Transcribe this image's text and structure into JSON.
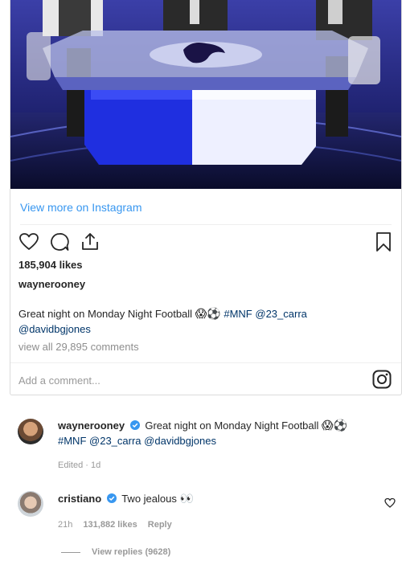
{
  "embed": {
    "view_more": "View more on Instagram",
    "likes": "185,904 likes",
    "username": "waynerooney",
    "caption_text": "Great night on Monday Night Football",
    "caption_emojis": "😱⚽",
    "caption_tags": [
      "#MNF",
      "@23_carra",
      "@davidbgjones"
    ],
    "view_all": "view all 29,895 comments",
    "add_comment_placeholder": "Add a comment...",
    "icons": [
      "heart-icon",
      "comment-icon",
      "share-icon",
      "bookmark-icon",
      "instagram-icon"
    ]
  },
  "comments": [
    {
      "user": "waynerooney",
      "text": "Great night on Monday Night Football",
      "emojis": "😱⚽",
      "tags": [
        "#MNF",
        "@23_carra",
        "@davidbgjones"
      ],
      "meta": "Edited · 1d"
    },
    {
      "user": "cristiano",
      "text": "Two jealous",
      "emojis": "👀",
      "time": "21h",
      "likes": "131,882 likes",
      "reply": "Reply",
      "view_replies": "View replies (9628)"
    }
  ],
  "colors": {
    "link": "#3897f0",
    "tag": "#003569",
    "muted": "#8e8e8e",
    "verified": "#3897f0"
  }
}
